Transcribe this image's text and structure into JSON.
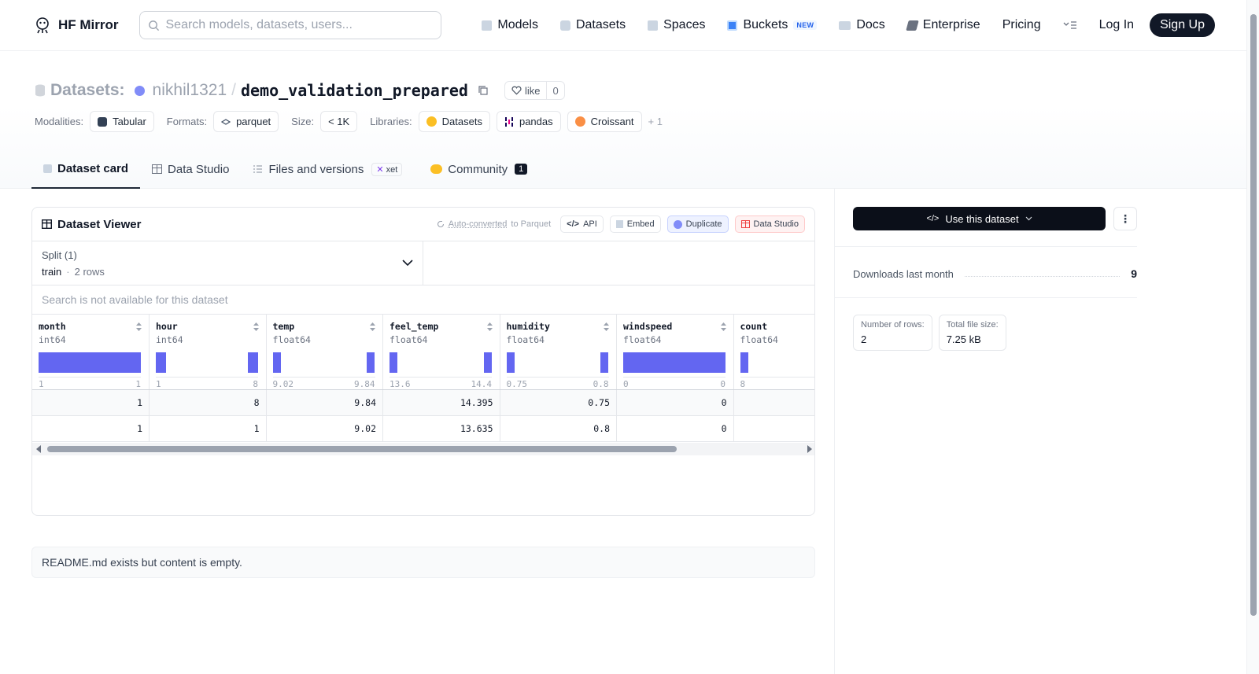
{
  "navbar": {
    "brand": "HF Mirror",
    "search_placeholder": "Search models, datasets, users...",
    "items": [
      {
        "label": "Models",
        "icon": "cube-icon",
        "color": "#9ca3af"
      },
      {
        "label": "Datasets",
        "icon": "database-icon",
        "color": "#9ca3af"
      },
      {
        "label": "Spaces",
        "icon": "grid-icon",
        "color": "#9ca3af"
      },
      {
        "label": "Buckets",
        "icon": "bucket-icon",
        "color": "#3b82f6",
        "badge": "NEW"
      },
      {
        "label": "Docs",
        "icon": "book-icon",
        "color": "#9ca3af"
      },
      {
        "label": "Enterprise",
        "icon": "enterprise-icon",
        "color": "#6b7280"
      },
      {
        "label": "Pricing"
      }
    ],
    "login": "Log In",
    "signup": "Sign Up"
  },
  "header": {
    "prefix": "Datasets:",
    "owner": "nikhil1321",
    "separator": "/",
    "name": "demo_validation_prepared",
    "like_label": "like",
    "like_count": "0",
    "meta": {
      "modalities_label": "Modalities:",
      "modality": "Tabular",
      "formats_label": "Formats:",
      "format": "parquet",
      "size_label": "Size:",
      "size": "< 1K",
      "libraries_label": "Libraries:",
      "libraries": [
        "Datasets",
        "pandas",
        "Croissant"
      ],
      "libraries_more": "+ 1"
    }
  },
  "tabs": [
    {
      "label": "Dataset card",
      "active": true
    },
    {
      "label": "Data Studio"
    },
    {
      "label": "Files and versions",
      "badge": "xet"
    },
    {
      "label": "Community",
      "count": "1"
    }
  ],
  "viewer": {
    "title": "Dataset Viewer",
    "auto_converted": "Auto-converted",
    "to_parquet": "to Parquet",
    "api": "API",
    "embed": "Embed",
    "duplicate": "Duplicate",
    "data_studio": "Data Studio",
    "split_label": "Split (1)",
    "split_value": "train",
    "split_rows": "2 rows",
    "search_na": "Search is not available for this dataset",
    "columns": [
      {
        "name": "month",
        "type": "int64",
        "min": "1",
        "max": "1",
        "hist": [
          {
            "pos": 0,
            "width": 1.0
          }
        ]
      },
      {
        "name": "hour",
        "type": "int64",
        "min": "1",
        "max": "8",
        "hist": [
          {
            "pos": 0,
            "width": 0.1
          },
          {
            "pos": 0.9,
            "width": 0.1
          }
        ]
      },
      {
        "name": "temp",
        "type": "float64",
        "min": "9.02",
        "max": "9.84",
        "hist": [
          {
            "pos": 0,
            "width": 0.08
          },
          {
            "pos": 0.92,
            "width": 0.08
          }
        ]
      },
      {
        "name": "feel_temp",
        "type": "float64",
        "min": "13.6",
        "max": "14.4",
        "hist": [
          {
            "pos": 0,
            "width": 0.08
          },
          {
            "pos": 0.92,
            "width": 0.08
          }
        ]
      },
      {
        "name": "humidity",
        "type": "float64",
        "min": "0.75",
        "max": "0.8",
        "hist": [
          {
            "pos": 0,
            "width": 0.08
          },
          {
            "pos": 0.92,
            "width": 0.08
          }
        ]
      },
      {
        "name": "windspeed",
        "type": "float64",
        "min": "0",
        "max": "0",
        "hist": [
          {
            "pos": 0,
            "width": 1.0
          }
        ]
      },
      {
        "name": "count",
        "type": "float64",
        "min": "8",
        "max": "",
        "hist": [
          {
            "pos": 0,
            "width": 0.08
          }
        ]
      }
    ],
    "rows": [
      [
        "1",
        "8",
        "9.84",
        "14.395",
        "0.75",
        "0",
        ""
      ],
      [
        "1",
        "1",
        "9.02",
        "13.635",
        "0.8",
        "0",
        ""
      ]
    ]
  },
  "readme": "README.md exists but content is empty.",
  "sidebar": {
    "use_dataset": "Use this dataset",
    "downloads_label": "Downloads last month",
    "downloads_value": "9",
    "rows_label": "Number of rows:",
    "rows_value": "2",
    "size_label": "Total file size:",
    "size_value": "7.25 kB"
  },
  "colors": {
    "accent": "#6366f1",
    "primary_dark": "#111827"
  }
}
